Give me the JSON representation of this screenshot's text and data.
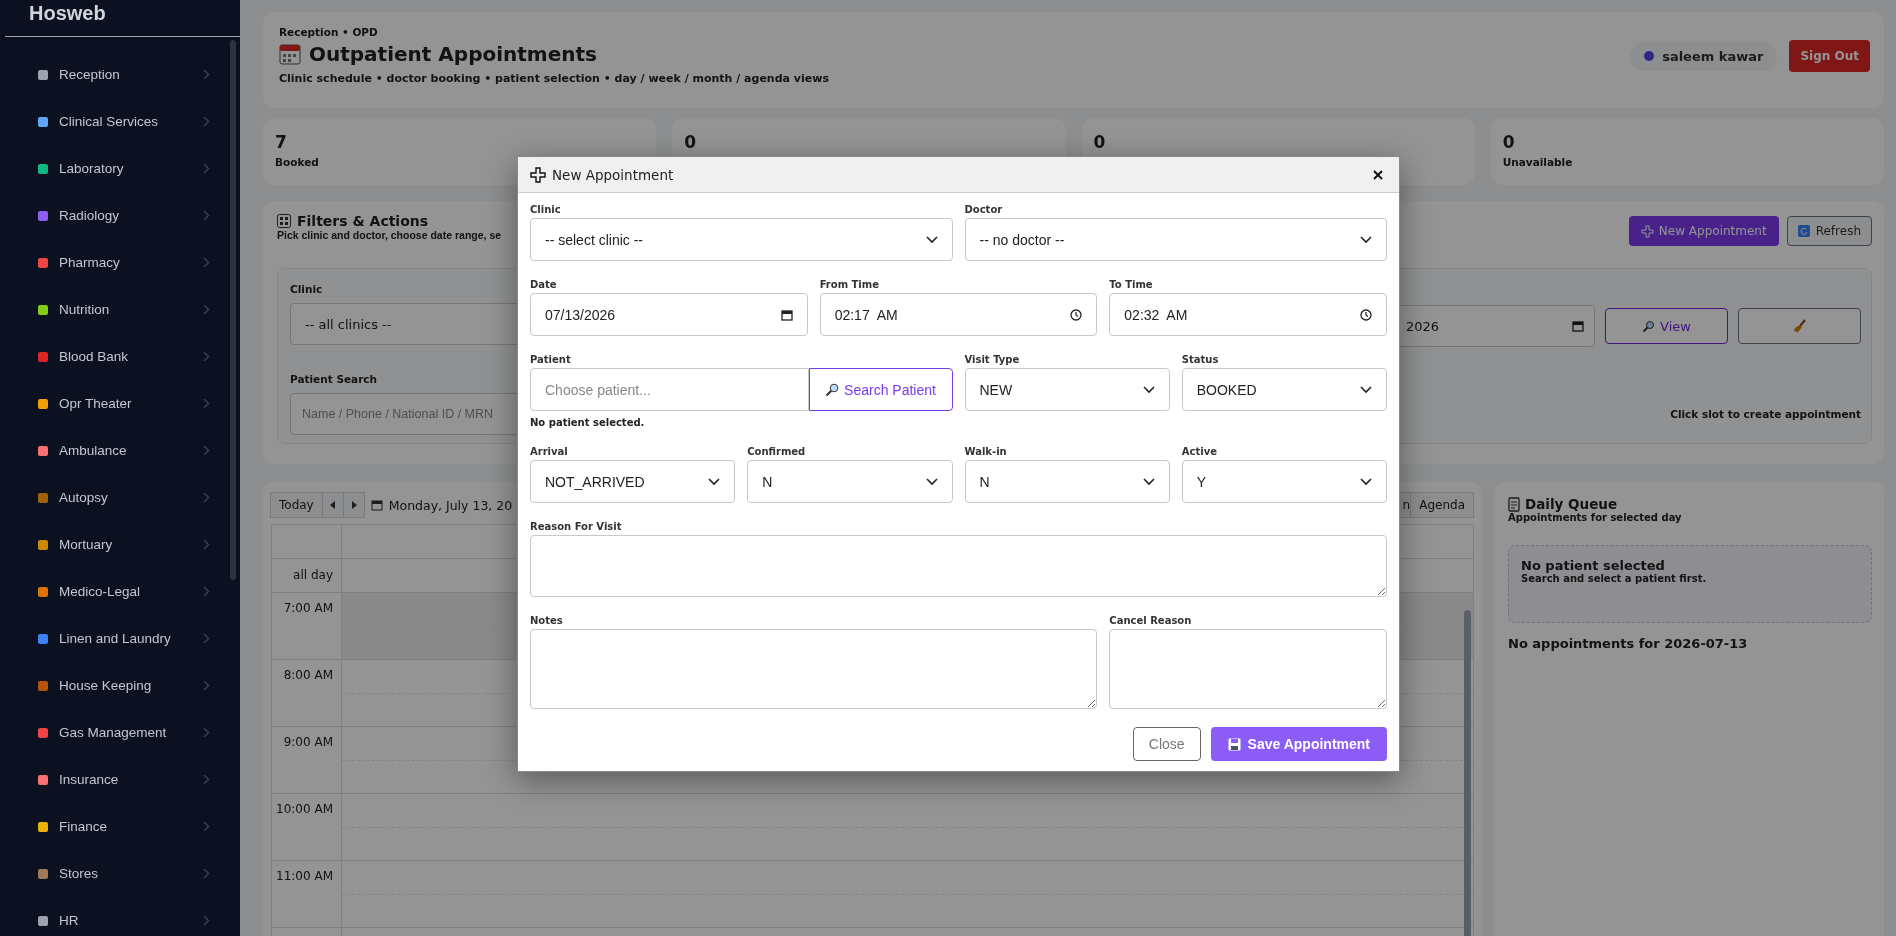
{
  "sidebar": {
    "logo": "Hosweb",
    "items": [
      {
        "label": "Reception"
      },
      {
        "label": "Clinical Services"
      },
      {
        "label": "Laboratory"
      },
      {
        "label": "Radiology"
      },
      {
        "label": "Pharmacy"
      },
      {
        "label": "Nutrition"
      },
      {
        "label": "Blood Bank"
      },
      {
        "label": "Opr Theater"
      },
      {
        "label": "Ambulance"
      },
      {
        "label": "Autopsy"
      },
      {
        "label": "Mortuary"
      },
      {
        "label": "Medico-Legal"
      },
      {
        "label": "Linen and Laundry"
      },
      {
        "label": "House Keeping"
      },
      {
        "label": "Gas Management"
      },
      {
        "label": "Insurance"
      },
      {
        "label": "Finance"
      },
      {
        "label": "Stores"
      },
      {
        "label": "HR"
      }
    ]
  },
  "header": {
    "breadcrumb": "Reception • OPD",
    "title": "Outpatient Appointments",
    "subtitle": "Clinic schedule • doctor booking • patient selection • day / week / month / agenda views",
    "user": "saleem kawar",
    "sign_out": "Sign Out"
  },
  "stats": [
    {
      "value": "7",
      "label": "Booked"
    },
    {
      "value": "0"
    },
    {
      "value": "0"
    },
    {
      "value": "0",
      "label": "Unavailable"
    }
  ],
  "filters": {
    "title": "Filters & Actions",
    "subtitle": "Pick clinic and doctor, choose date range, se",
    "new_button": "New Appointment",
    "refresh_button": "Refresh",
    "clinic_label": "Clinic",
    "clinic_value": "-- all clinics --",
    "patient_label": "Patient Search",
    "patient_placeholder": "Name / Phone / National ID / MRN",
    "date_value": "2026",
    "view_button": "View",
    "hint": "Click slot to create appointment"
  },
  "calendar": {
    "today": "Today",
    "date": "Monday, July 13, 20",
    "views": [
      "n",
      "Agenda"
    ],
    "all_day": "all day",
    "times": [
      "7:00 AM",
      "8:00 AM",
      "9:00 AM",
      "10:00 AM",
      "11:00 AM"
    ]
  },
  "queue": {
    "title": "Daily Queue",
    "subtitle": "Appointments for selected day",
    "empty_title": "No patient selected",
    "empty_text": "Search and select a patient first.",
    "none_text": "No appointments for 2026-07-13"
  },
  "modal": {
    "title": "New Appointment",
    "clinic": {
      "label": "Clinic",
      "value": "-- select clinic --"
    },
    "doctor": {
      "label": "Doctor",
      "value": "-- no doctor --"
    },
    "date": {
      "label": "Date",
      "value": "07/13/2026"
    },
    "from_time": {
      "label": "From Time",
      "value": "02:17  AM"
    },
    "to_time": {
      "label": "To Time",
      "value": "02:32  AM"
    },
    "patient": {
      "label": "Patient",
      "placeholder": "Choose patient...",
      "button": "Search Patient",
      "status": "No patient selected."
    },
    "visit_type": {
      "label": "Visit Type",
      "value": "NEW"
    },
    "status": {
      "label": "Status",
      "value": "BOOKED"
    },
    "arrival": {
      "label": "Arrival",
      "value": "NOT_ARRIVED"
    },
    "confirmed": {
      "label": "Confirmed",
      "value": "N"
    },
    "walk_in": {
      "label": "Walk-in",
      "value": "N"
    },
    "active": {
      "label": "Active",
      "value": "Y"
    },
    "reason": {
      "label": "Reason For Visit"
    },
    "notes": {
      "label": "Notes"
    },
    "cancel_reason": {
      "label": "Cancel Reason"
    },
    "close_button": "Close",
    "save_button": "Save Appointment"
  }
}
